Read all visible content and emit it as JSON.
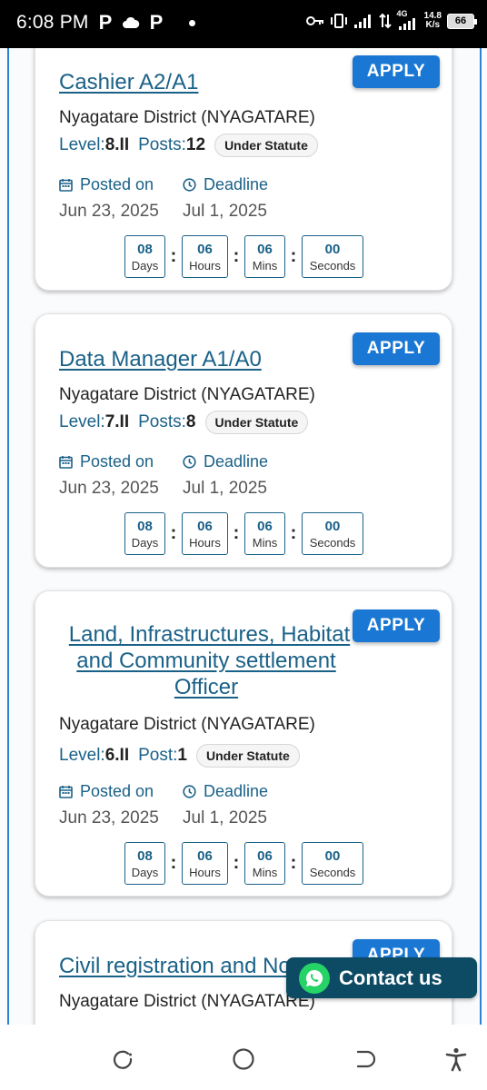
{
  "status_bar": {
    "time": "6:08 PM",
    "left_icons": [
      "P",
      "cloud",
      "P",
      "dot"
    ],
    "net_type": "4G",
    "speed_value": "14.8",
    "speed_unit": "K/s",
    "battery": "66"
  },
  "jobs": [
    {
      "title": "Cashier A2/A1",
      "district": "Nyagatare District (NYAGATARE)",
      "level_label": "Level:",
      "level": "8.II",
      "posts_label": "Posts:",
      "posts": "12",
      "statute": "Under Statute",
      "apply_label": "APPLY",
      "posted_label": "Posted on",
      "posted_date": "Jun 23, 2025",
      "deadline_label": "Deadline",
      "deadline_date": "Jul 1, 2025",
      "countdown": {
        "days": "08",
        "days_label": "Days",
        "hours": "06",
        "hours_label": "Hours",
        "mins": "06",
        "mins_label": "Mins",
        "seconds": "00",
        "seconds_label": "Seconds"
      }
    },
    {
      "title": "Data Manager A1/A0",
      "district": "Nyagatare District (NYAGATARE)",
      "level_label": "Level:",
      "level": "7.II",
      "posts_label": "Posts:",
      "posts": "8",
      "statute": "Under Statute",
      "apply_label": "APPLY",
      "posted_label": "Posted on",
      "posted_date": "Jun 23, 2025",
      "deadline_label": "Deadline",
      "deadline_date": "Jul 1, 2025",
      "countdown": {
        "days": "08",
        "days_label": "Days",
        "hours": "06",
        "hours_label": "Hours",
        "mins": "06",
        "mins_label": "Mins",
        "seconds": "00",
        "seconds_label": "Seconds"
      }
    },
    {
      "title_lines": [
        "Land, Infrastructures, Habitat",
        "and Community settlement",
        "Officer"
      ],
      "district": "Nyagatare District (NYAGATARE)",
      "level_label": "Level:",
      "level": "6.II",
      "posts_label": "Post:",
      "posts": "1",
      "statute": "Under Statute",
      "apply_label": "APPLY",
      "posted_label": "Posted on",
      "posted_date": "Jun 23, 2025",
      "deadline_label": "Deadline",
      "deadline_date": "Jul 1, 2025",
      "countdown": {
        "days": "08",
        "days_label": "Days",
        "hours": "06",
        "hours_label": "Hours",
        "mins": "06",
        "mins_label": "Mins",
        "seconds": "00",
        "seconds_label": "Seconds"
      }
    },
    {
      "title": "Civil registration and No",
      "district": "Nyagatare District (NYAGATARE)",
      "apply_label": "APPLY"
    }
  ],
  "contact_button": {
    "label": "Contact us",
    "icon": "whatsapp-icon"
  },
  "nav_bar": {
    "icons": [
      "recent-apps-icon",
      "home-icon",
      "back-icon",
      "accessibility-icon"
    ]
  },
  "colors": {
    "accent": "#1a78d4",
    "title": "#1a6188",
    "contact_bg": "#0d4a63",
    "whatsapp": "#25d366"
  }
}
